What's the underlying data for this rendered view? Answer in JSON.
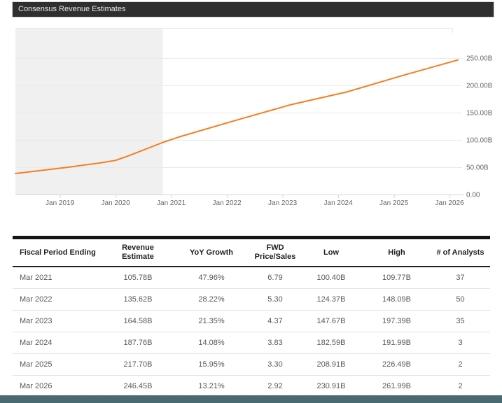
{
  "section_header": {
    "title": "Consensus Revenue Estimates"
  },
  "colors": {
    "header_bg": "#2f2f2f",
    "header_text": "#e9e9e9",
    "line": "#f57e20",
    "plot_band": "#f0f0f0",
    "grid": "#e9e9e9",
    "axis": "#ccd6eb",
    "tick_label": "#666666",
    "footer_bar": "#4a6a72"
  },
  "chart_data": {
    "type": "line",
    "title": "Consensus Revenue Estimates",
    "x_range": [
      2018.2,
      2026.2
    ],
    "ylim": [
      0,
      305
    ],
    "grid": true,
    "legend": "none",
    "y_ticks": [
      {
        "value": 0,
        "label": "0.00"
      },
      {
        "value": 50,
        "label": "50.00B"
      },
      {
        "value": 100,
        "label": "100.00B"
      },
      {
        "value": 150,
        "label": "150.00B"
      },
      {
        "value": 200,
        "label": "200.00B"
      },
      {
        "value": 250,
        "label": "250.00B"
      }
    ],
    "x_ticks": [
      {
        "year": 2019,
        "label": "Jan 2019"
      },
      {
        "year": 2020,
        "label": "Jan 2020"
      },
      {
        "year": 2021,
        "label": "Jan 2021"
      },
      {
        "year": 2022,
        "label": "Jan 2022"
      },
      {
        "year": 2023,
        "label": "Jan 2023"
      },
      {
        "year": 2024,
        "label": "Jan 2024"
      },
      {
        "year": 2025,
        "label": "Jan 2025"
      },
      {
        "year": 2026,
        "label": "Jan 2026"
      }
    ],
    "plot_band": {
      "from": 2018.2,
      "to": 2020.85
    },
    "series": [
      {
        "name": "Revenue Estimates",
        "color": "#f57e20",
        "unit": "B",
        "points": [
          [
            2018.2,
            38.5
          ],
          [
            2019.15,
            50.0
          ],
          [
            2019.7,
            57.5
          ],
          [
            2020.0,
            62.5
          ],
          [
            2020.25,
            71.5
          ],
          [
            2020.85,
            95.5
          ],
          [
            2021.15,
            105.78
          ],
          [
            2022.15,
            135.62
          ],
          [
            2023.15,
            164.58
          ],
          [
            2024.15,
            187.76
          ],
          [
            2025.15,
            217.7
          ],
          [
            2026.15,
            246.45
          ]
        ]
      }
    ]
  },
  "table": {
    "columns": [
      {
        "label": "Fiscal Period Ending"
      },
      {
        "label": "Revenue\nEstimate"
      },
      {
        "label": "YoY Growth"
      },
      {
        "label": "FWD\nPrice/Sales"
      },
      {
        "label": "Low"
      },
      {
        "label": "High"
      },
      {
        "label": "# of Analysts"
      }
    ],
    "rows": [
      [
        "Mar 2021",
        "105.78B",
        "47.96%",
        "6.79",
        "100.40B",
        "109.77B",
        "37"
      ],
      [
        "Mar 2022",
        "135.62B",
        "28.22%",
        "5.30",
        "124.37B",
        "148.09B",
        "50"
      ],
      [
        "Mar 2023",
        "164.58B",
        "21.35%",
        "4.37",
        "147.67B",
        "197.39B",
        "35"
      ],
      [
        "Mar 2024",
        "187.76B",
        "14.08%",
        "3.83",
        "182.59B",
        "191.99B",
        "3"
      ],
      [
        "Mar 2025",
        "217.70B",
        "15.95%",
        "3.30",
        "208.91B",
        "226.49B",
        "2"
      ],
      [
        "Mar 2026",
        "246.45B",
        "13.21%",
        "2.92",
        "230.91B",
        "261.99B",
        "2"
      ]
    ]
  }
}
